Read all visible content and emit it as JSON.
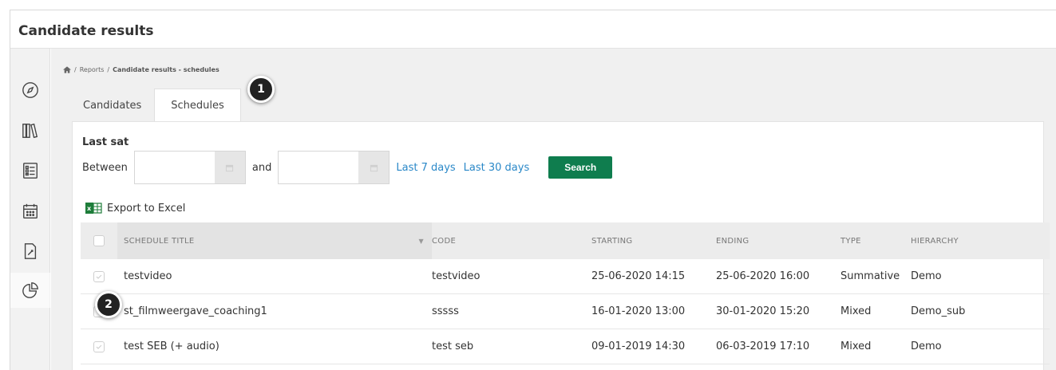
{
  "window": {
    "title": "Candidate results"
  },
  "sidebar": {
    "items": [
      {
        "icon": "compass-icon"
      },
      {
        "icon": "library-icon"
      },
      {
        "icon": "list-icon"
      },
      {
        "icon": "calendar-icon"
      },
      {
        "icon": "document-edit-icon"
      },
      {
        "icon": "pie-chart-icon",
        "active": true
      }
    ]
  },
  "breadcrumb": {
    "icon": "home-icon",
    "items": [
      "Reports",
      "Candidate results - schedules"
    ],
    "separator": "/"
  },
  "tabs": [
    {
      "label": "Candidates",
      "active": false
    },
    {
      "label": "Schedules",
      "active": true
    }
  ],
  "filter": {
    "section_label": "Last sat",
    "between_label": "Between",
    "and_label": "and",
    "from_value": "",
    "to_value": "",
    "quick_links": [
      "Last 7 days",
      "Last 30 days"
    ],
    "search_label": "Search"
  },
  "export": {
    "label": "Export to Excel"
  },
  "table": {
    "columns": [
      "SCHEDULE TITLE",
      "CODE",
      "STARTING",
      "ENDING",
      "TYPE",
      "HIERARCHY"
    ],
    "rows": [
      {
        "title": "testvideo",
        "code": "testvideo",
        "starting": "25-06-2020 14:15",
        "ending": "25-06-2020 16:00",
        "type": "Summative",
        "hierarchy": "Demo"
      },
      {
        "title": "st_filmweergave_coaching1",
        "code": "sssss",
        "starting": "16-01-2020 13:00",
        "ending": "30-01-2020 15:20",
        "type": "Mixed",
        "hierarchy": "Demo_sub"
      },
      {
        "title": "test SEB (+ audio)",
        "code": "test seb",
        "starting": "09-01-2019 14:30",
        "ending": "06-03-2019 17:10",
        "type": "Mixed",
        "hierarchy": "Demo"
      }
    ]
  },
  "annotations": [
    {
      "label": "1"
    },
    {
      "label": "2"
    }
  ],
  "colors": {
    "accent_green": "#0f7d4e",
    "link_blue": "#2a88c8",
    "badge": "#222222"
  }
}
